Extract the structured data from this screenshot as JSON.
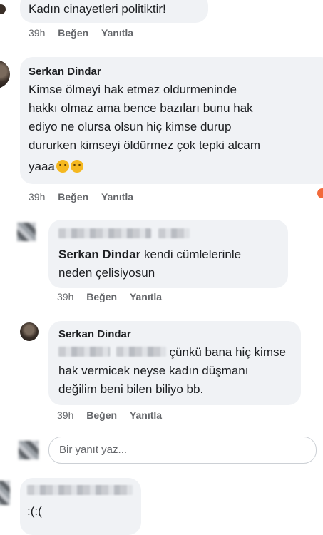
{
  "comment1": {
    "text": "Kadın cinayetleri politiktir!",
    "time": "39h",
    "like": "Beğen",
    "reply": "Yanıtla"
  },
  "comment2": {
    "author": "Serkan Dindar",
    "lines": [
      "Kimse ölmeyi hak etmez oldurmeninde",
      "hakkı olmaz ama bence bazıları bunu hak",
      "ediyo ne olursa olsun hiç kimse durup",
      "dururken kimseyi öldürmez çok tepki alcam",
      "yaaa"
    ],
    "time": "39h",
    "like": "Beğen",
    "reply": "Yanıtla"
  },
  "reply1": {
    "mention": "Serkan Dindar",
    "text_line1": " kendi cümlelerinle",
    "text_line2": "neden çelisiyosun",
    "time": "39h",
    "like": "Beğen",
    "reply": "Yanıtla"
  },
  "reply2": {
    "author": "Serkan Dindar",
    "text_line1": "çünkü bana hiç kimse",
    "text_line2": "hak vermicek  neyse kadın düşmanı",
    "text_line3": "değilim beni bilen biliyo bb.",
    "time": "39h",
    "like": "Beğen",
    "reply": "Yanıtla"
  },
  "reply_box": {
    "placeholder": "Bir yanıt yaz..."
  },
  "comment3": {
    "text": ":(:("
  },
  "icons": {
    "emoji": "sad-face-icon",
    "reaction": "angry-reaction-icon"
  },
  "colors": {
    "bubble": "#f0f2f5",
    "meta": "#65676b",
    "text": "#1c1e21"
  }
}
